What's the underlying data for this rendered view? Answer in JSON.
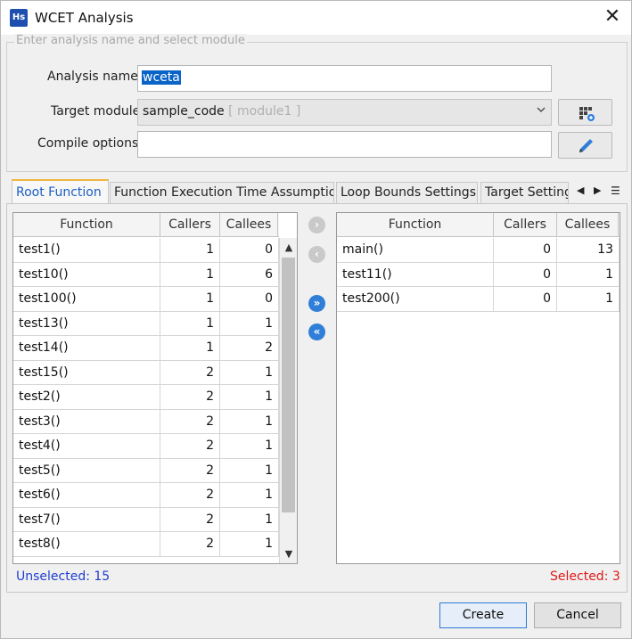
{
  "window": {
    "title": "WCET Analysis",
    "app_icon_text": "Hs",
    "close_glyph": "✕"
  },
  "form": {
    "legend": "Enter analysis name and select module",
    "analysis_name_label": "Analysis name",
    "analysis_name_value": "wceta",
    "target_module_label": "Target module",
    "target_module_value": "sample_code",
    "target_module_hint": "[ module1 ]",
    "compile_options_label": "Compile options",
    "compile_options_value": "",
    "module_button_icon": "grid-add-icon",
    "edit_button_icon": "pencil-icon"
  },
  "tabs": [
    {
      "label": "Root Function",
      "active": true
    },
    {
      "label": "Function Execution Time Assumption",
      "active": false
    },
    {
      "label": "Loop Bounds Settings",
      "active": false
    },
    {
      "label": "Target Setting",
      "active": false
    }
  ],
  "left_table": {
    "columns": [
      "Function",
      "Callers",
      "Callees"
    ],
    "rows": [
      [
        "test1()",
        "1",
        "0"
      ],
      [
        "test10()",
        "1",
        "6"
      ],
      [
        "test100()",
        "1",
        "0"
      ],
      [
        "test13()",
        "1",
        "1"
      ],
      [
        "test14()",
        "1",
        "2"
      ],
      [
        "test15()",
        "2",
        "1"
      ],
      [
        "test2()",
        "2",
        "1"
      ],
      [
        "test3()",
        "2",
        "1"
      ],
      [
        "test4()",
        "2",
        "1"
      ],
      [
        "test5()",
        "2",
        "1"
      ],
      [
        "test6()",
        "2",
        "1"
      ],
      [
        "test7()",
        "2",
        "1"
      ],
      [
        "test8()",
        "2",
        "1"
      ]
    ]
  },
  "right_table": {
    "columns": [
      "Function",
      "Callers",
      "Callees"
    ],
    "rows": [
      [
        "main()",
        "0",
        "13"
      ],
      [
        "test11()",
        "0",
        "1"
      ],
      [
        "test200()",
        "0",
        "1"
      ]
    ]
  },
  "move_buttons": {
    "move_right_one": "›",
    "move_left_one": "‹",
    "move_right_all": "»",
    "move_left_all": "«"
  },
  "status": {
    "unselected": "Unselected: 15",
    "selected": "Selected: 3"
  },
  "buttons": {
    "create": "Create",
    "cancel": "Cancel"
  },
  "colors": {
    "accent": "#2f7ed8",
    "tab_active_text": "#1b5fc2",
    "tab_active_border": "#f0b640",
    "unselected_text": "#1f3fd0",
    "selected_text": "#e01919"
  }
}
